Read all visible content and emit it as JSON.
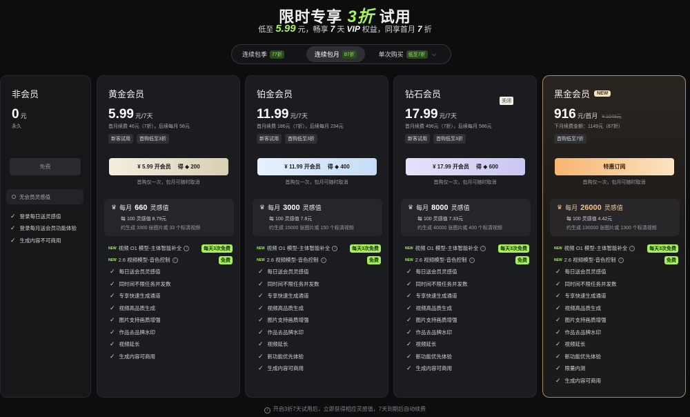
{
  "hero": {
    "title_prefix": "限时专享",
    "title_hl": "3折",
    "title_suffix": "试用",
    "sub_1": "低至",
    "sub_price": "5.99",
    "sub_2": "元，畅享",
    "sub_days": "7",
    "sub_3": "天",
    "sub_vip": "VIP",
    "sub_4": "权益，同享首月",
    "sub_discount": "7",
    "sub_5": "折"
  },
  "tabs": [
    {
      "label": "连续包季",
      "badge": "77折",
      "active": false
    },
    {
      "label": "连续包月",
      "badge": "87折",
      "active": true
    },
    {
      "label": "单次购买",
      "badge": "低至7折",
      "active": false
    }
  ],
  "cards": {
    "free": {
      "title": "非会员",
      "price": "0",
      "unit": "元",
      "renew": "永久",
      "cta": "免费",
      "no_points": "无会员灵感值",
      "features": [
        "登录每日送灵感值",
        "登录每月送会员功能体验",
        "生成内容不可商用"
      ]
    },
    "gold": {
      "title": "黄金会员",
      "price": "5.99",
      "unit": "元/7天",
      "renew": "首月续费 46元（7折），后续每月 58元",
      "chips": [
        "新客试用",
        "首购低至3折"
      ],
      "cta": "¥ 5.99 开会员",
      "cta_points": "得 ◆ 200",
      "cta_note": "首购仅一次，包月可随时取消",
      "quota_prefix": "每月",
      "quota_num": "660",
      "quota_suffix": "灵感值",
      "quota_line2": "每 100 灵感值 8.79元",
      "quota_line3": "约生成 3300 张图片或 33 个标清视频",
      "model1": "视频 O1 模型-主体智能补全",
      "model1_pill": "每天3次免费",
      "model2": "2.6 视频模型-音色控制",
      "model2_pill": "免费",
      "features": [
        "每日送会员灵感值",
        "同时间不限任务并发数",
        "专享快速生成通道",
        "视频高品质生成",
        "图片支持画质增强",
        "作品去品牌水印",
        "视频延长",
        "生成内容可商用"
      ]
    },
    "plat": {
      "title": "铂金会员",
      "price": "11.99",
      "unit": "元/7天",
      "renew": "首月续费 186元（7折），后续每月 234元",
      "chips": [
        "新客试用",
        "首购低至3折"
      ],
      "cta": "¥ 11.99 开会员",
      "cta_points": "得 ◆ 400",
      "cta_note": "首购仅一次，包月可随时取消",
      "quota_prefix": "每月",
      "quota_num": "3000",
      "quota_suffix": "灵感值",
      "quota_line2": "每 100 灵感值 7.8元",
      "quota_line3": "约生成 15000 张图片或 150 个标清视频",
      "model1": "视频 O1 模型-主体智能补全",
      "model1_pill": "每天3次免费",
      "model2": "2.6 视频模型-音色控制",
      "model2_pill": "免费",
      "features": [
        "每日送会员灵感值",
        "同时间不限任务并发数",
        "专享快速生成通道",
        "视频高品质生成",
        "图片支持画质增强",
        "作品去品牌水印",
        "视频延长",
        "新功能优先体验",
        "生成内容可商用"
      ]
    },
    "diamond": {
      "title": "钻石会员",
      "close_tag": "关闭",
      "price": "17.99",
      "unit": "元/7天",
      "renew": "首月续费 496元（7折），后续每月 586元",
      "chips": [
        "新客试用",
        "首购低至3折"
      ],
      "cta": "¥ 17.99 开会员",
      "cta_points": "得 ◆ 600",
      "cta_note": "首购仅一次，包月可随时取消",
      "quota_prefix": "每月",
      "quota_num": "8000",
      "quota_suffix": "灵感值",
      "quota_line2": "每 100 灵感值 7.33元",
      "quota_line3": "约生成 40000 张图片或 400 个标清视频",
      "model1": "视频 O1 模型-主体智能补全",
      "model1_pill": "每天3次免费",
      "model2": "2.6 视频模型-音色控制",
      "model2_pill": "免费",
      "features": [
        "每日送会员灵感值",
        "同时间不限任务并发数",
        "专享快速生成通道",
        "视频高品质生成",
        "图片支持画质增强",
        "作品去品牌水印",
        "视频延长",
        "新功能优先体验",
        "生成内容可商用"
      ]
    },
    "black": {
      "title": "黑金会员",
      "new_tag": "NEW",
      "price": "916",
      "unit": "元/首月",
      "strike": "¥ 1049元",
      "renew": "下月续费金额：1149元（87折）",
      "chips": [
        "首购低至7折"
      ],
      "cta": "特惠订阅",
      "cta_note": "首购仅一次，包月可随时取消",
      "quota_prefix": "每月",
      "quota_num": "26000",
      "quota_suffix": "灵感值",
      "quota_line2": "每 100 灵感值 4.42元",
      "quota_line3": "约生成 130000 张图片或 1300 个标清视频",
      "model1": "视频 O1 模型-主体智能补全",
      "model1_pill": "每天3次免费",
      "model2": "2.6 视频模型-音色控制",
      "model2_pill": "免费",
      "features": [
        "每日送会员灵感值",
        "同时间不限任务并发数",
        "专享快速生成通道",
        "视频高品质生成",
        "图片支持画质增强",
        "作品去品牌水印",
        "视频延长",
        "新功能优先体验",
        "限量内测",
        "生成内容可商用"
      ]
    }
  },
  "footer": "开启3折7天试用后，立即获得相应灵感值，7天到期后自动续费"
}
